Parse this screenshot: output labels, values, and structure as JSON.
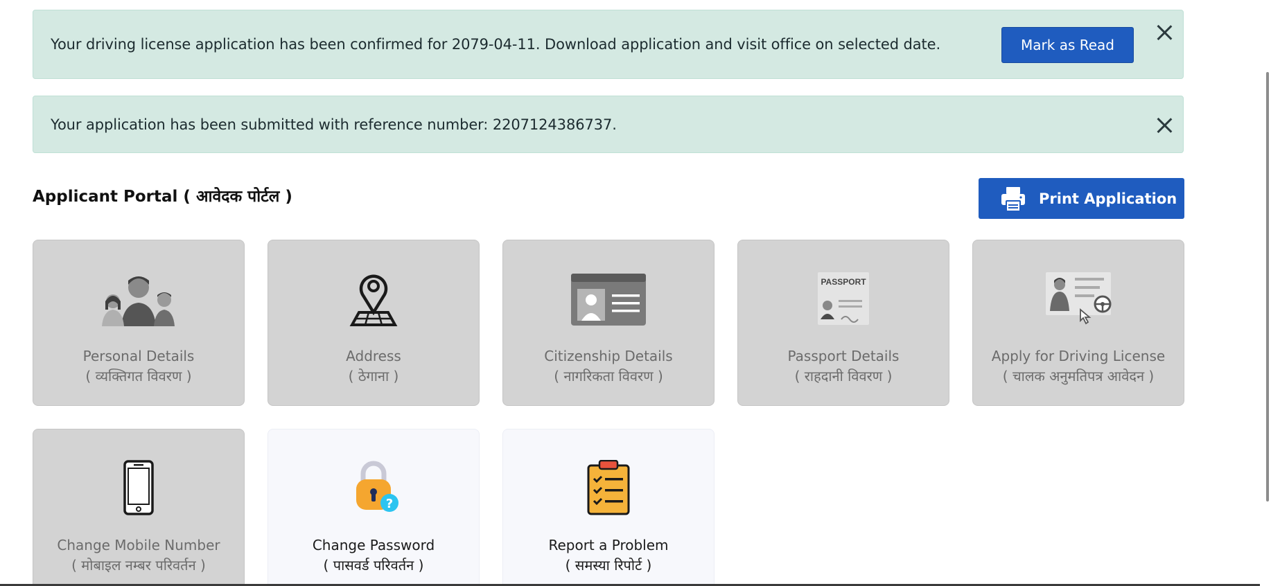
{
  "notifications": [
    {
      "message": "Your driving license application has been confirmed for 2079-04-11. Download application and visit office on selected date.",
      "action_label": "Mark as Read"
    },
    {
      "message": "Your application has been submitted with reference number: 2207124386737."
    }
  ],
  "portal": {
    "title": "Applicant Portal ( आवेदक पोर्टल )",
    "print_label": "Print Application"
  },
  "cards": [
    {
      "title": "Personal Details",
      "subtitle": "( व्यक्तिगत विवरण )",
      "icon": "family-icon",
      "state": "disabled"
    },
    {
      "title": "Address",
      "subtitle": "( ठेगाना )",
      "icon": "map-pin-icon",
      "state": "disabled"
    },
    {
      "title": "Citizenship Details",
      "subtitle": "( नागरिकता विवरण )",
      "icon": "id-card-icon",
      "state": "disabled"
    },
    {
      "title": "Passport Details",
      "subtitle": "( राहदानी विवरण )",
      "icon": "passport-icon",
      "state": "disabled"
    },
    {
      "title": "Apply for Driving License",
      "subtitle": "( चालक अनुमतिपत्र आवेदन )",
      "icon": "driving-license-icon",
      "state": "disabled"
    },
    {
      "title": "Change Mobile Number",
      "subtitle": "( मोबाइल नम्बर परिवर्तन )",
      "icon": "mobile-phone-icon",
      "state": "disabled"
    },
    {
      "title": "Change Password",
      "subtitle": "( पासवर्ड परिवर्तन )",
      "icon": "lock-question-icon",
      "state": "active"
    },
    {
      "title": "Report a Problem",
      "subtitle": "( समस्या रिपोर्ट )",
      "icon": "clipboard-checklist-icon",
      "state": "active"
    }
  ],
  "colors": {
    "alert_bg": "#d4e9e2",
    "primary": "#1f5cbf",
    "card_disabled": "#d3d3d3",
    "card_active": "#f7f8fc"
  }
}
